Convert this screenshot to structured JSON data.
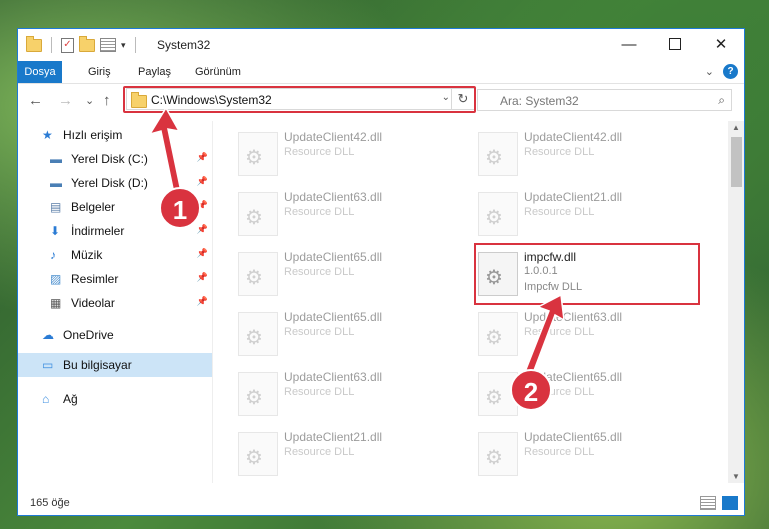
{
  "window": {
    "title": "System32",
    "controls": {
      "minimize": "—",
      "maximize": "",
      "close": "✕"
    }
  },
  "ribbon": {
    "tabs": [
      "Dosya",
      "Giriş",
      "Paylaş",
      "Görünüm"
    ],
    "help": "?"
  },
  "nav": {
    "back": "←",
    "forward": "→",
    "recent": "⌄",
    "up": "↑",
    "address": "C:\\Windows\\System32",
    "search_placeholder": "Ara: System32"
  },
  "sidebar": {
    "items": [
      {
        "label": "Hızlı erişim",
        "icon": "star-icon",
        "pinned": false
      },
      {
        "label": "Yerel Disk (C:)",
        "icon": "drive-icon",
        "pinned": true
      },
      {
        "label": "Yerel Disk (D:)",
        "icon": "drive-icon",
        "pinned": true
      },
      {
        "label": "Belgeler",
        "icon": "documents-icon",
        "pinned": true
      },
      {
        "label": "İndirmeler",
        "icon": "downloads-icon",
        "pinned": true
      },
      {
        "label": "Müzik",
        "icon": "music-icon",
        "pinned": true
      },
      {
        "label": "Resimler",
        "icon": "pictures-icon",
        "pinned": true
      },
      {
        "label": "Videolar",
        "icon": "videos-icon",
        "pinned": true
      },
      {
        "label": "OneDrive",
        "icon": "onedrive-icon",
        "pinned": false
      },
      {
        "label": "Bu bilgisayar",
        "icon": "computer-icon",
        "pinned": false,
        "selected": true
      },
      {
        "label": "Ağ",
        "icon": "network-icon",
        "pinned": false
      }
    ]
  },
  "files": [
    {
      "name": "UpdateClient42.dll",
      "desc": "Resource DLL"
    },
    {
      "name": "UpdateClient42.dll",
      "desc": "Resource DLL"
    },
    {
      "name": "UpdateClient63.dll",
      "desc": "Resource DLL"
    },
    {
      "name": "UpdateClient21.dll",
      "desc": "Resource DLL"
    },
    {
      "name": "UpdateClient65.dll",
      "desc": "Resource DLL"
    },
    {
      "name": "impcfw.dll",
      "version": "1.0.0.1",
      "desc": "Impcfw DLL",
      "highlighted": true
    },
    {
      "name": "UpdateClient65.dll",
      "desc": "Resource DLL"
    },
    {
      "name": "UpdateClient63.dll",
      "desc": "Resource DLL"
    },
    {
      "name": "UpdateClient63.dll",
      "desc": "Resource DLL"
    },
    {
      "name": "UpdateClient65.dll",
      "desc": "Resource DLL"
    },
    {
      "name": "UpdateClient21.dll",
      "desc": "Resource DLL"
    },
    {
      "name": "UpdateClient65.dll",
      "desc": "Resource DLL"
    }
  ],
  "status": {
    "count": "165 öğe"
  },
  "annotations": {
    "step1": "1",
    "step2": "2",
    "color": "#d9333f"
  }
}
